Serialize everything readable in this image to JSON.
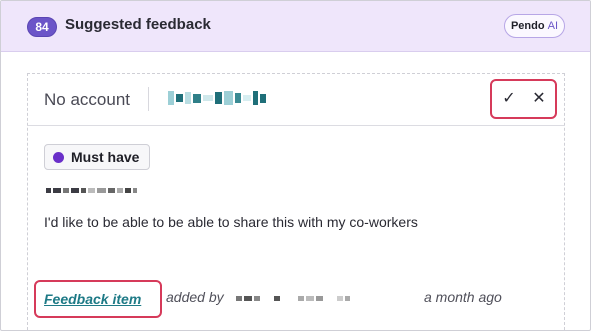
{
  "header": {
    "count": "84",
    "title": "Suggested feedback",
    "pendo_label": "Pendo",
    "ai_label": "AI"
  },
  "card": {
    "account_label": "No account",
    "accept_icon": "check-icon",
    "reject_icon": "close-icon",
    "accept_glyph": "✓",
    "reject_glyph": "✕",
    "tag_label": "Must have",
    "tag_color": "#6a2fc9",
    "feedback_text": "I'd like to be able to be able to share this with my co-workers",
    "feedback_link": "Feedback item",
    "added_by": "added by",
    "time_ago": "a month ago"
  },
  "colors": {
    "header_bg": "#efe6fb",
    "accent": "#6b55c8",
    "link": "#1e7a86",
    "highlight": "#d63a5a"
  }
}
